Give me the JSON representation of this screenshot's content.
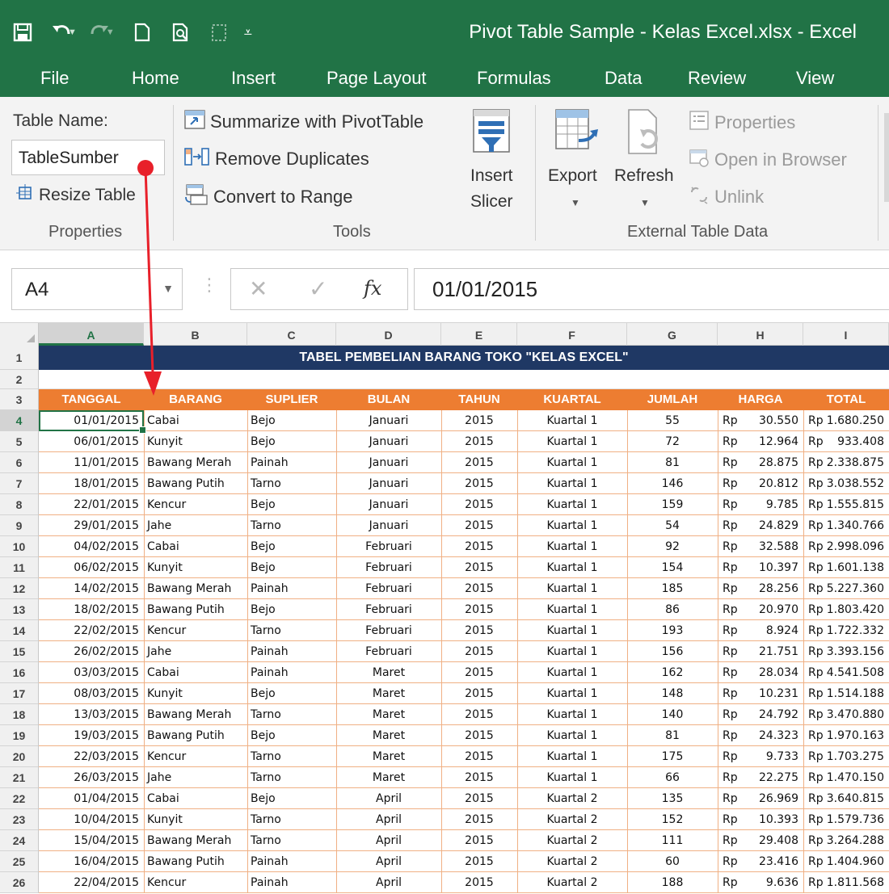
{
  "window": {
    "title": "Pivot Table Sample - Kelas Excel.xlsx - Excel"
  },
  "tabs": [
    "File",
    "Home",
    "Insert",
    "Page Layout",
    "Formulas",
    "Data",
    "Review",
    "View"
  ],
  "ribbon": {
    "properties": {
      "table_name_label": "Table Name:",
      "table_name_value": "TableSumber",
      "resize_table": "Resize Table",
      "group_title": "Properties"
    },
    "tools": {
      "summarize": "Summarize with PivotTable",
      "remove_duplicates": "Remove Duplicates",
      "convert_to_range": "Convert to Range",
      "insert_slicer_1": "Insert",
      "insert_slicer_2": "Slicer",
      "group_title": "Tools"
    },
    "external": {
      "export": "Export",
      "refresh": "Refresh",
      "properties": "Properties",
      "open_in_browser": "Open in Browser",
      "unlink": "Unlink",
      "group_title": "External Table Data"
    }
  },
  "formula_bar": {
    "name_box": "A4",
    "fx": "fx",
    "value": "01/01/2015"
  },
  "colors": {
    "excel_green": "#217346",
    "title_band": "#1f3864",
    "header_orange": "#ed7d31",
    "annotation_red": "#e8202a"
  },
  "columns": [
    "A",
    "B",
    "C",
    "D",
    "E",
    "F",
    "G",
    "H",
    "I"
  ],
  "row_numbers": [
    "1",
    "2",
    "3",
    "4",
    "5",
    "6",
    "7",
    "8",
    "9",
    "10",
    "11",
    "12",
    "13",
    "14",
    "15",
    "16",
    "17",
    "18",
    "19",
    "20",
    "21",
    "22",
    "23",
    "24",
    "25",
    "26"
  ],
  "sheet": {
    "title": "TABEL PEMBELIAN BARANG TOKO \"KELAS EXCEL\"",
    "headers": [
      "TANGGAL",
      "BARANG",
      "SUPLIER",
      "BULAN",
      "TAHUN",
      "KUARTAL",
      "JUMLAH",
      "HARGA",
      "TOTAL"
    ],
    "rows": [
      [
        "01/01/2015",
        "Cabai",
        "Bejo",
        "Januari",
        "2015",
        "Kuartal 1",
        "55",
        "30.550",
        "1.680.250"
      ],
      [
        "06/01/2015",
        "Kunyit",
        "Bejo",
        "Januari",
        "2015",
        "Kuartal 1",
        "72",
        "12.964",
        "933.408"
      ],
      [
        "11/01/2015",
        "Bawang Merah",
        "Painah",
        "Januari",
        "2015",
        "Kuartal 1",
        "81",
        "28.875",
        "2.338.875"
      ],
      [
        "18/01/2015",
        "Bawang Putih",
        "Tarno",
        "Januari",
        "2015",
        "Kuartal 1",
        "146",
        "20.812",
        "3.038.552"
      ],
      [
        "22/01/2015",
        "Kencur",
        "Bejo",
        "Januari",
        "2015",
        "Kuartal 1",
        "159",
        "9.785",
        "1.555.815"
      ],
      [
        "29/01/2015",
        "Jahe",
        "Tarno",
        "Januari",
        "2015",
        "Kuartal 1",
        "54",
        "24.829",
        "1.340.766"
      ],
      [
        "04/02/2015",
        "Cabai",
        "Bejo",
        "Februari",
        "2015",
        "Kuartal 1",
        "92",
        "32.588",
        "2.998.096"
      ],
      [
        "06/02/2015",
        "Kunyit",
        "Bejo",
        "Februari",
        "2015",
        "Kuartal 1",
        "154",
        "10.397",
        "1.601.138"
      ],
      [
        "14/02/2015",
        "Bawang Merah",
        "Painah",
        "Februari",
        "2015",
        "Kuartal 1",
        "185",
        "28.256",
        "5.227.360"
      ],
      [
        "18/02/2015",
        "Bawang Putih",
        "Bejo",
        "Februari",
        "2015",
        "Kuartal 1",
        "86",
        "20.970",
        "1.803.420"
      ],
      [
        "22/02/2015",
        "Kencur",
        "Tarno",
        "Februari",
        "2015",
        "Kuartal 1",
        "193",
        "8.924",
        "1.722.332"
      ],
      [
        "26/02/2015",
        "Jahe",
        "Painah",
        "Februari",
        "2015",
        "Kuartal 1",
        "156",
        "21.751",
        "3.393.156"
      ],
      [
        "03/03/2015",
        "Cabai",
        "Painah",
        "Maret",
        "2015",
        "Kuartal 1",
        "162",
        "28.034",
        "4.541.508"
      ],
      [
        "08/03/2015",
        "Kunyit",
        "Bejo",
        "Maret",
        "2015",
        "Kuartal 1",
        "148",
        "10.231",
        "1.514.188"
      ],
      [
        "13/03/2015",
        "Bawang Merah",
        "Tarno",
        "Maret",
        "2015",
        "Kuartal 1",
        "140",
        "24.792",
        "3.470.880"
      ],
      [
        "19/03/2015",
        "Bawang Putih",
        "Bejo",
        "Maret",
        "2015",
        "Kuartal 1",
        "81",
        "24.323",
        "1.970.163"
      ],
      [
        "22/03/2015",
        "Kencur",
        "Tarno",
        "Maret",
        "2015",
        "Kuartal 1",
        "175",
        "9.733",
        "1.703.275"
      ],
      [
        "26/03/2015",
        "Jahe",
        "Tarno",
        "Maret",
        "2015",
        "Kuartal 1",
        "66",
        "22.275",
        "1.470.150"
      ],
      [
        "01/04/2015",
        "Cabai",
        "Bejo",
        "April",
        "2015",
        "Kuartal 2",
        "135",
        "26.969",
        "3.640.815"
      ],
      [
        "10/04/2015",
        "Kunyit",
        "Tarno",
        "April",
        "2015",
        "Kuartal 2",
        "152",
        "10.393",
        "1.579.736"
      ],
      [
        "15/04/2015",
        "Bawang Merah",
        "Tarno",
        "April",
        "2015",
        "Kuartal 2",
        "111",
        "29.408",
        "3.264.288"
      ],
      [
        "16/04/2015",
        "Bawang Putih",
        "Painah",
        "April",
        "2015",
        "Kuartal 2",
        "60",
        "23.416",
        "1.404.960"
      ],
      [
        "22/04/2015",
        "Kencur",
        "Painah",
        "April",
        "2015",
        "Kuartal 2",
        "188",
        "9.636",
        "1.811.568"
      ]
    ],
    "currency": "Rp"
  }
}
